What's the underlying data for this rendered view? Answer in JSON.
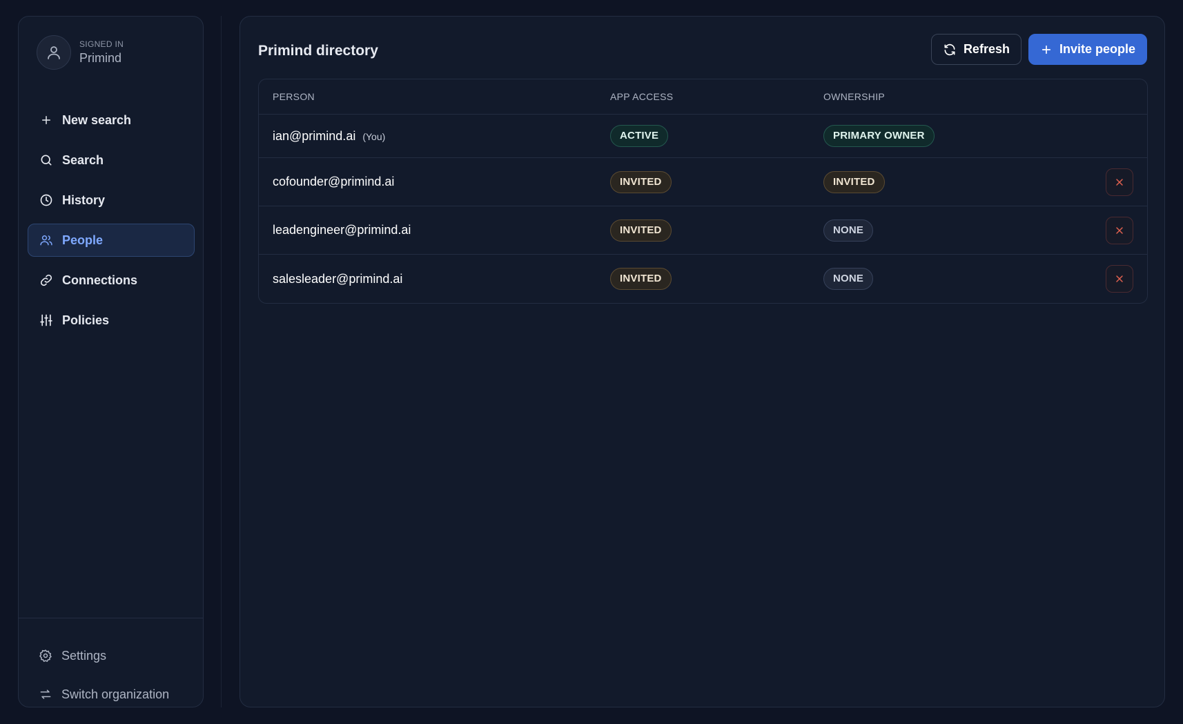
{
  "sidebar": {
    "signed_in_label": "SIGNED IN",
    "org_name": "Primind",
    "nav": [
      {
        "label": "New search",
        "icon": "plus-icon"
      },
      {
        "label": "Search",
        "icon": "search-icon"
      },
      {
        "label": "History",
        "icon": "clock-icon"
      },
      {
        "label": "People",
        "icon": "users-icon",
        "active": true
      },
      {
        "label": "Connections",
        "icon": "link-icon"
      },
      {
        "label": "Policies",
        "icon": "sliders-icon"
      }
    ],
    "bottom": [
      {
        "label": "Settings",
        "icon": "gear-icon"
      },
      {
        "label": "Switch organization",
        "icon": "switch-icon"
      }
    ]
  },
  "main": {
    "title": "Primind directory",
    "refresh_label": "Refresh",
    "invite_label": "Invite people",
    "columns": [
      "PERSON",
      "APP ACCESS",
      "OWNERSHIP"
    ],
    "rows": [
      {
        "email": "ian@primind.ai",
        "tag": "(You)",
        "app_access": "ACTIVE",
        "ownership": "PRIMARY OWNER"
      },
      {
        "email": "cofounder@primind.ai",
        "app_access": "INVITED",
        "ownership": "INVITED"
      },
      {
        "email": "leadengineer@primind.ai",
        "app_access": "INVITED",
        "ownership": "NONE"
      },
      {
        "email": "salesleader@primind.ai",
        "app_access": "INVITED",
        "ownership": "NONE"
      }
    ]
  },
  "colors": {
    "background": "#0e1424",
    "panel": "#121a2b",
    "accent": "#3568d4",
    "active_nav_text": "#7fa9ff",
    "remove_icon": "#e0614f"
  }
}
